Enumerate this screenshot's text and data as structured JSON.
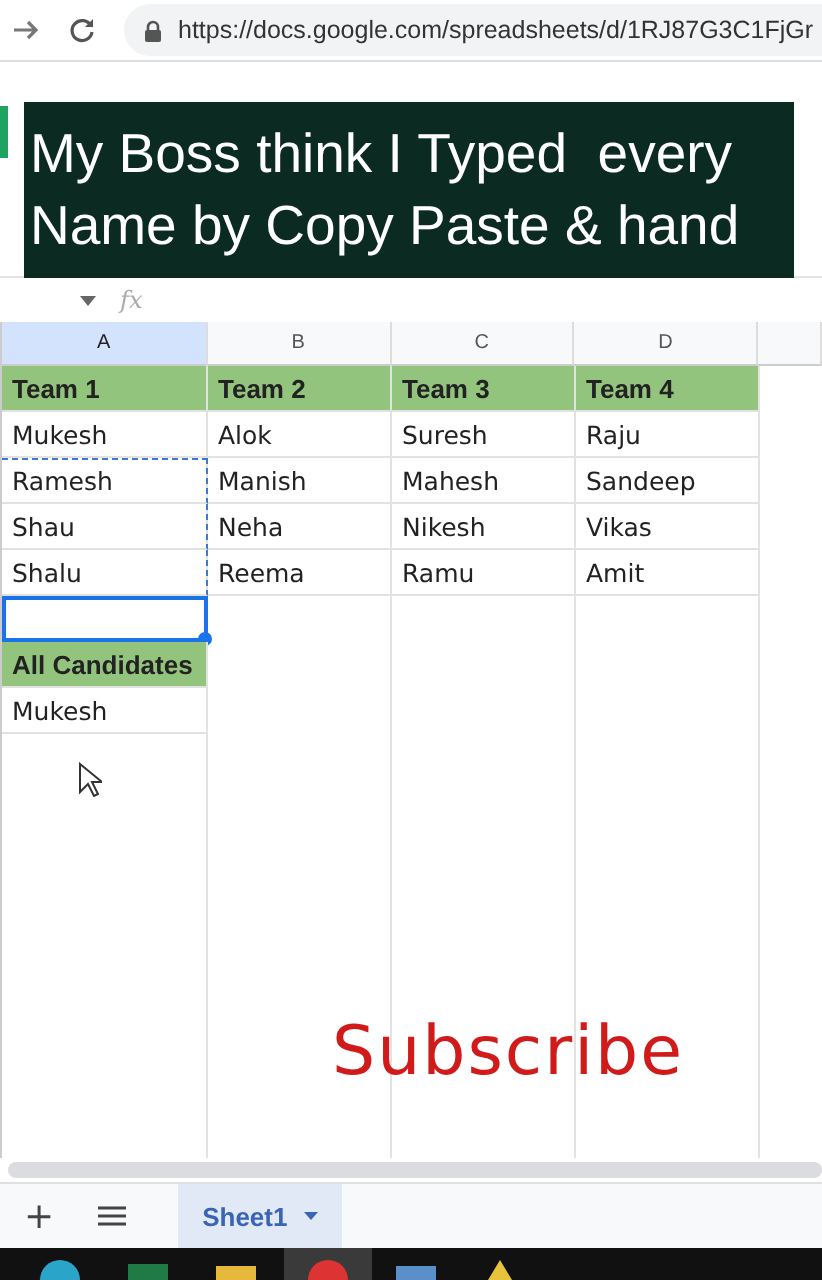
{
  "browser": {
    "url": "https://docs.google.com/spreadsheets/d/1RJ87G3C1FjGr"
  },
  "caption": [
    "My Boss think I Typed  every",
    "Name by Copy Paste & hand"
  ],
  "formula_bar": {
    "fx": "fx"
  },
  "columns": [
    {
      "label": "A",
      "selected": true
    },
    {
      "label": "B",
      "selected": false
    },
    {
      "label": "C",
      "selected": false
    },
    {
      "label": "D",
      "selected": false
    }
  ],
  "rows": [
    {
      "cells": [
        {
          "text": "Team 1",
          "kind": "header",
          "selected": false,
          "copied": false
        },
        {
          "text": "Team 2",
          "kind": "header",
          "selected": false,
          "copied": false
        },
        {
          "text": "Team 3",
          "kind": "header",
          "selected": false,
          "copied": false
        },
        {
          "text": "Team 4",
          "kind": "header",
          "selected": false,
          "copied": false
        }
      ]
    },
    {
      "cells": [
        {
          "text": "Mukesh",
          "kind": "plain",
          "selected": false,
          "copied": false
        },
        {
          "text": "Alok",
          "kind": "plain",
          "selected": false,
          "copied": false
        },
        {
          "text": "Suresh",
          "kind": "plain",
          "selected": false,
          "copied": false
        },
        {
          "text": "Raju",
          "kind": "plain",
          "selected": false,
          "copied": false
        }
      ]
    },
    {
      "cells": [
        {
          "text": "Ramesh",
          "kind": "plain",
          "selected": false,
          "copied": true
        },
        {
          "text": "Manish",
          "kind": "plain",
          "selected": false,
          "copied": false
        },
        {
          "text": "Mahesh",
          "kind": "plain",
          "selected": false,
          "copied": false
        },
        {
          "text": "Sandeep",
          "kind": "plain",
          "selected": false,
          "copied": false
        }
      ]
    },
    {
      "cells": [
        {
          "text": "Shau",
          "kind": "plain",
          "selected": false,
          "copied": true
        },
        {
          "text": "Neha",
          "kind": "plain",
          "selected": false,
          "copied": false
        },
        {
          "text": "Nikesh",
          "kind": "plain",
          "selected": false,
          "copied": false
        },
        {
          "text": "Vikas",
          "kind": "plain",
          "selected": false,
          "copied": false
        }
      ]
    },
    {
      "cells": [
        {
          "text": "Shalu",
          "kind": "plain",
          "selected": false,
          "copied": true
        },
        {
          "text": "Reema",
          "kind": "plain",
          "selected": false,
          "copied": false
        },
        {
          "text": "Ramu",
          "kind": "plain",
          "selected": false,
          "copied": false
        },
        {
          "text": "Amit",
          "kind": "plain",
          "selected": false,
          "copied": false
        }
      ]
    },
    {
      "cells": [
        {
          "kind": "plain",
          "selected": true,
          "copied": false
        }
      ]
    },
    {
      "cells": [
        {
          "text": "All Candidates",
          "kind": "header",
          "selected": false,
          "copied": false
        }
      ]
    },
    {
      "cells": [
        {
          "text": "Mukesh",
          "kind": "plain",
          "selected": false,
          "copied": false
        }
      ]
    }
  ],
  "overlay_text": "Subscribe",
  "sheet_tabs": {
    "add": "+",
    "tabs": [
      {
        "label": "Sheet1",
        "selected": true
      }
    ]
  }
}
